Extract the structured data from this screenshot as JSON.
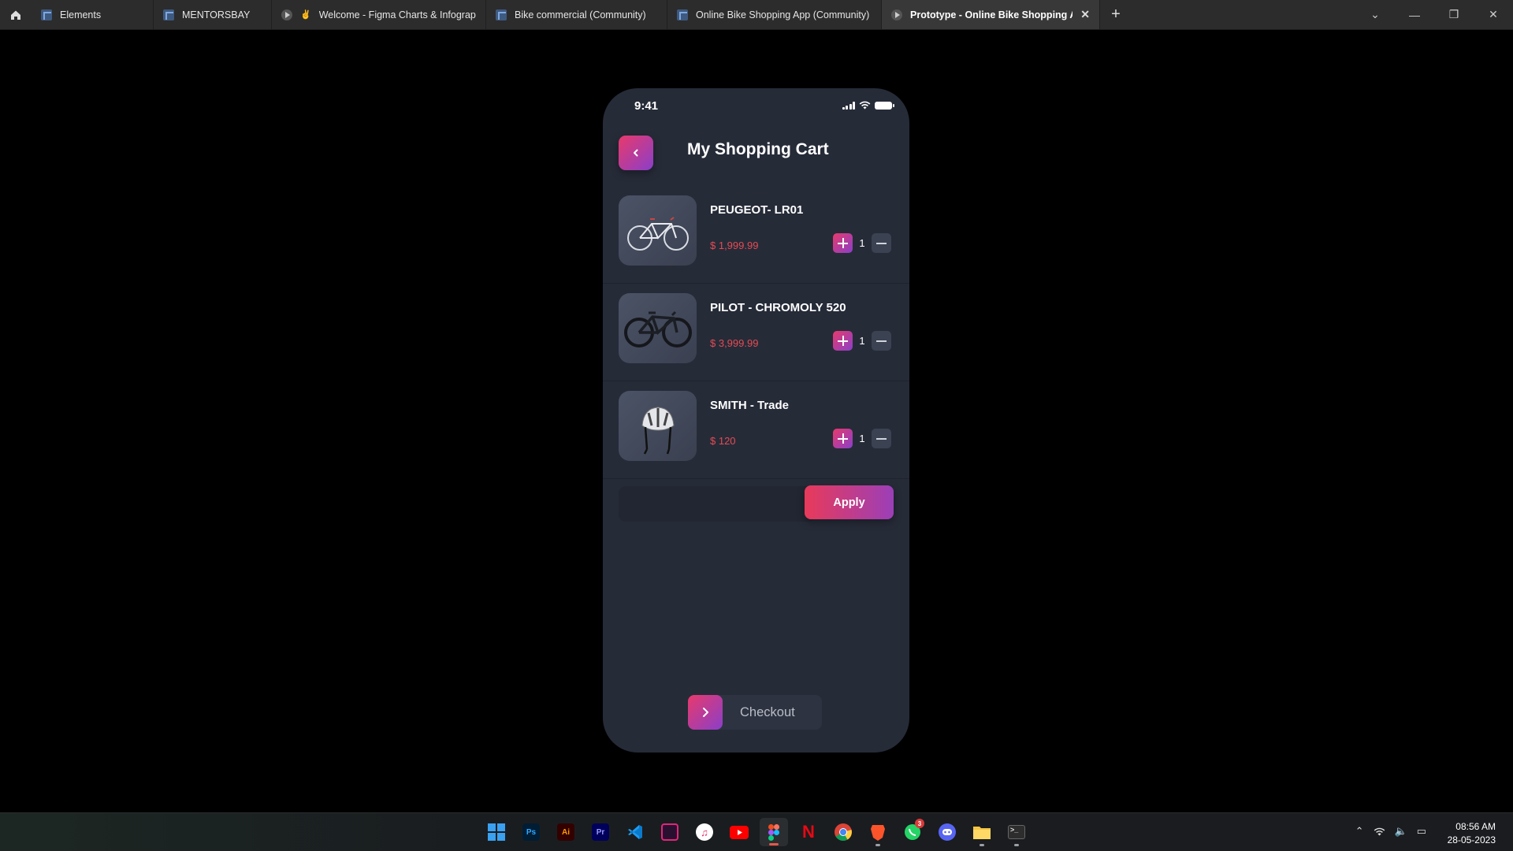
{
  "browser_tabs": [
    {
      "label": "Elements",
      "icon": "figma-file-icon"
    },
    {
      "label": "MENTORSBAY",
      "icon": "figma-file-icon"
    },
    {
      "label": "Welcome - Figma Charts & Infographic",
      "icon": "play-icon"
    },
    {
      "label": "Bike commercial (Community)",
      "icon": "figma-file-icon"
    },
    {
      "label": "Online Bike Shopping App (Community)",
      "icon": "figma-file-icon"
    },
    {
      "label": "Prototype - Online Bike Shopping App (",
      "icon": "play-icon",
      "active": true
    }
  ],
  "phone": {
    "status_time": "9:41",
    "title": "My Shopping Cart",
    "items": [
      {
        "name": "PEUGEOT- LR01",
        "price": "$ 1,999.99",
        "qty": "1",
        "image": "road-bike-image"
      },
      {
        "name": "PILOT - CHROMOLY 520",
        "price": "$ 3,999.99",
        "qty": "1",
        "image": "race-bike-image"
      },
      {
        "name": "SMITH - Trade",
        "price": "$ 120",
        "qty": "1",
        "image": "helmet-image"
      }
    ],
    "coupon": {
      "value": "",
      "apply_label": "Apply"
    },
    "checkout_label": "Checkout",
    "accent_gradient": [
      "#e83a6b",
      "#8a3fc9"
    ],
    "price_color": "#e44c54"
  },
  "taskbar": {
    "apps": [
      "windows-start-icon",
      "photoshop-icon",
      "illustrator-icon",
      "premiere-icon",
      "vscode-icon",
      "stack-icon",
      "itunes-icon",
      "youtube-icon",
      "figma-icon",
      "netflix-icon",
      "chrome-icon",
      "brave-icon",
      "whatsapp-icon",
      "discord-icon",
      "file-explorer-icon",
      "terminal-icon"
    ],
    "whatsapp_badge": "3",
    "clock_time": "08:56 AM",
    "clock_date": "28-05-2023"
  }
}
